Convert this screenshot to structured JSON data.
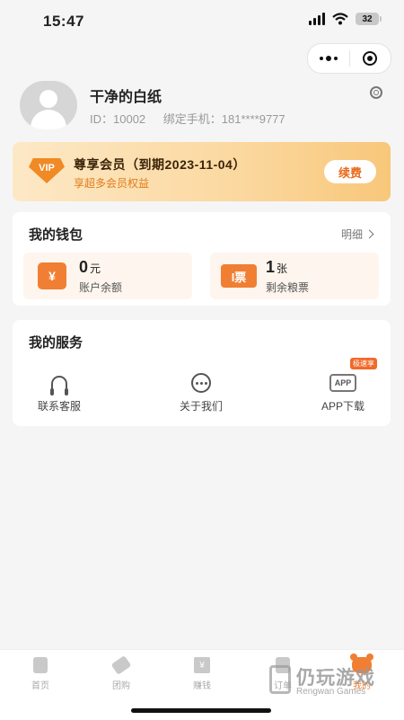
{
  "status_bar": {
    "time": "15:47",
    "battery": "32"
  },
  "profile": {
    "name": "干净的白纸",
    "id_text": "ID：10002",
    "phone_text": "绑定手机：181****9777"
  },
  "vip": {
    "badge": "VIP",
    "title": "尊享会员（到期2023-11-04）",
    "subtitle": "享超多会员权益",
    "renew_label": "续费"
  },
  "wallet": {
    "title": "我的钱包",
    "detail_label": "明细",
    "balance": {
      "icon_text": "¥",
      "value": "0",
      "unit": "元",
      "label": "账户余额"
    },
    "tickets": {
      "icon_text": "I票",
      "value": "1",
      "unit": "张",
      "label": "剩余粮票"
    }
  },
  "services": {
    "title": "我的服务",
    "items": [
      {
        "label": "联系客服",
        "icon": "headset-icon"
      },
      {
        "label": "关于我们",
        "icon": "more-circle-icon"
      },
      {
        "label": "APP下载",
        "icon": "app-icon",
        "icon_text": "APP",
        "tag": "极速享"
      }
    ]
  },
  "tabbar": {
    "items": [
      {
        "label": "首页",
        "icon": "home-utensils-icon"
      },
      {
        "label": "团购",
        "icon": "tag-icon"
      },
      {
        "label": "赚钱",
        "icon": "book-icon",
        "icon_text": "¥"
      },
      {
        "label": "订单",
        "icon": "order-icon"
      },
      {
        "label": "我的",
        "icon": "bear-icon",
        "active": true
      }
    ]
  },
  "watermark": {
    "title": "仍玩游戏",
    "subtitle": "Rengwan Games"
  },
  "colors": {
    "accent": "#f07f33",
    "vip_text": "#3b2308",
    "vip_sub": "#e07c1c"
  }
}
